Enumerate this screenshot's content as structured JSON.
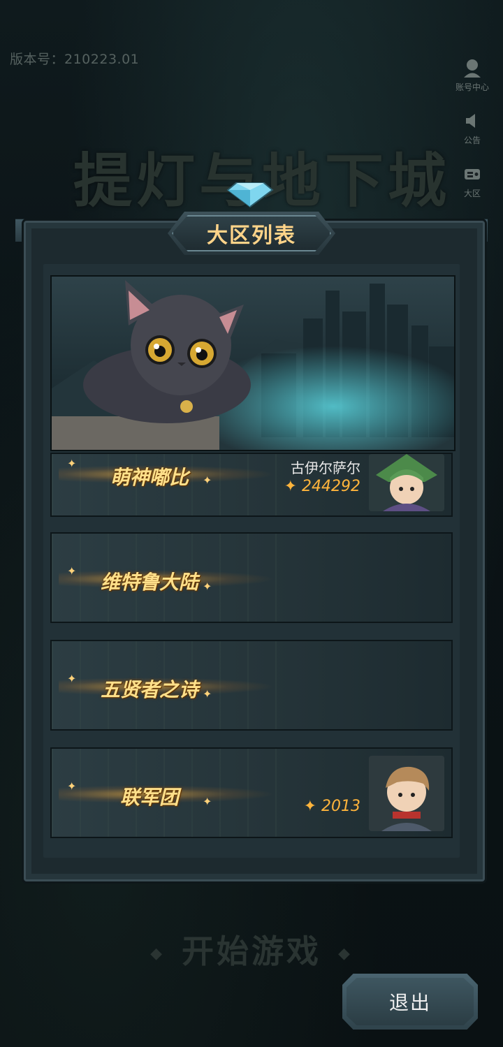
{
  "version_text": "版本号：210223.01",
  "side_menu": [
    {
      "label": "账号中心",
      "icon": "user-icon"
    },
    {
      "label": "公告",
      "icon": "speaker-icon"
    },
    {
      "label": "大区",
      "icon": "server-icon"
    }
  ],
  "game_title": "提灯与地下城",
  "panel": {
    "title": "大区列表",
    "servers": [
      {
        "name": "萌神嘟比",
        "character": "古伊尔萨尔",
        "score": "244292",
        "has_character": true
      },
      {
        "name": "维特鲁大陆",
        "character": "",
        "score": "",
        "has_character": false
      },
      {
        "name": "五贤者之诗",
        "character": "",
        "score": "",
        "has_character": false
      },
      {
        "name": "联军团",
        "character": "",
        "score": "2013",
        "has_character": true
      }
    ]
  },
  "start_button": "开始游戏",
  "exit_button": "退出",
  "colors": {
    "gold_text": "#ffe08a",
    "score": "#ffb43c",
    "panel": "#1d2a2f"
  }
}
